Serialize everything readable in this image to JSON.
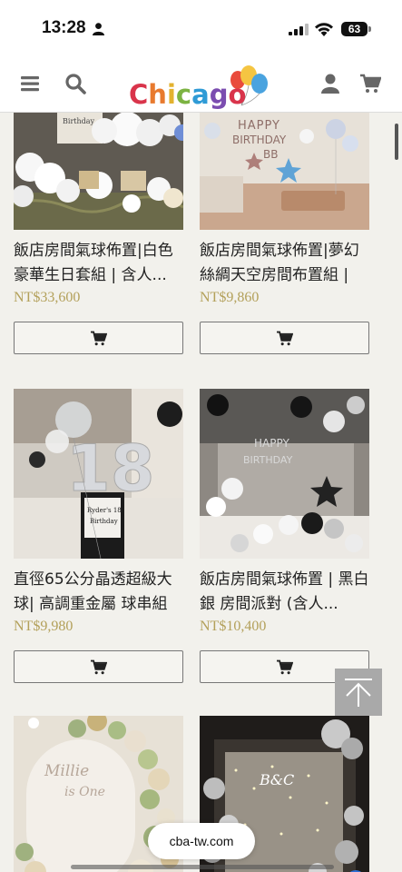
{
  "status_bar": {
    "time": "13:28",
    "battery": "63"
  },
  "header": {
    "logo_text": "Chicago",
    "icons": [
      "menu-icon",
      "search-icon",
      "user-icon",
      "cart-icon"
    ]
  },
  "products": [
    {
      "title": "飯店房間氣球佈置|白色豪華生日套組 | 含人...",
      "price": "NT$33,600"
    },
    {
      "title": "飯店房間氣球佈置|夢幻絲綢天空房間布置組 |",
      "price": "NT$9,860"
    },
    {
      "title": "直徑65公分晶透超級大球| 高調重金屬 球串組",
      "price": "NT$9,980"
    },
    {
      "title": "飯店房間氣球佈置 | 黑白銀 房間派對 (含人...",
      "price": "NT$10,400"
    },
    {
      "title": "",
      "price": ""
    },
    {
      "title": "",
      "price": ""
    }
  ],
  "image_text": {
    "p1_sign": "Birthday",
    "p2_banner": "HAPPY BIRTHDAY BB",
    "p3_sign": "Ryder's 18 Birthday",
    "p3_balloon": "18",
    "p4_banner": "HAPPY BIRTHDAY",
    "p5_sign": "Millie is One",
    "p6_sign": "B&C"
  },
  "browser": {
    "url": "cba-tw.com"
  },
  "colors": {
    "price": "#b3a05a",
    "background": "#f2f1ec"
  }
}
